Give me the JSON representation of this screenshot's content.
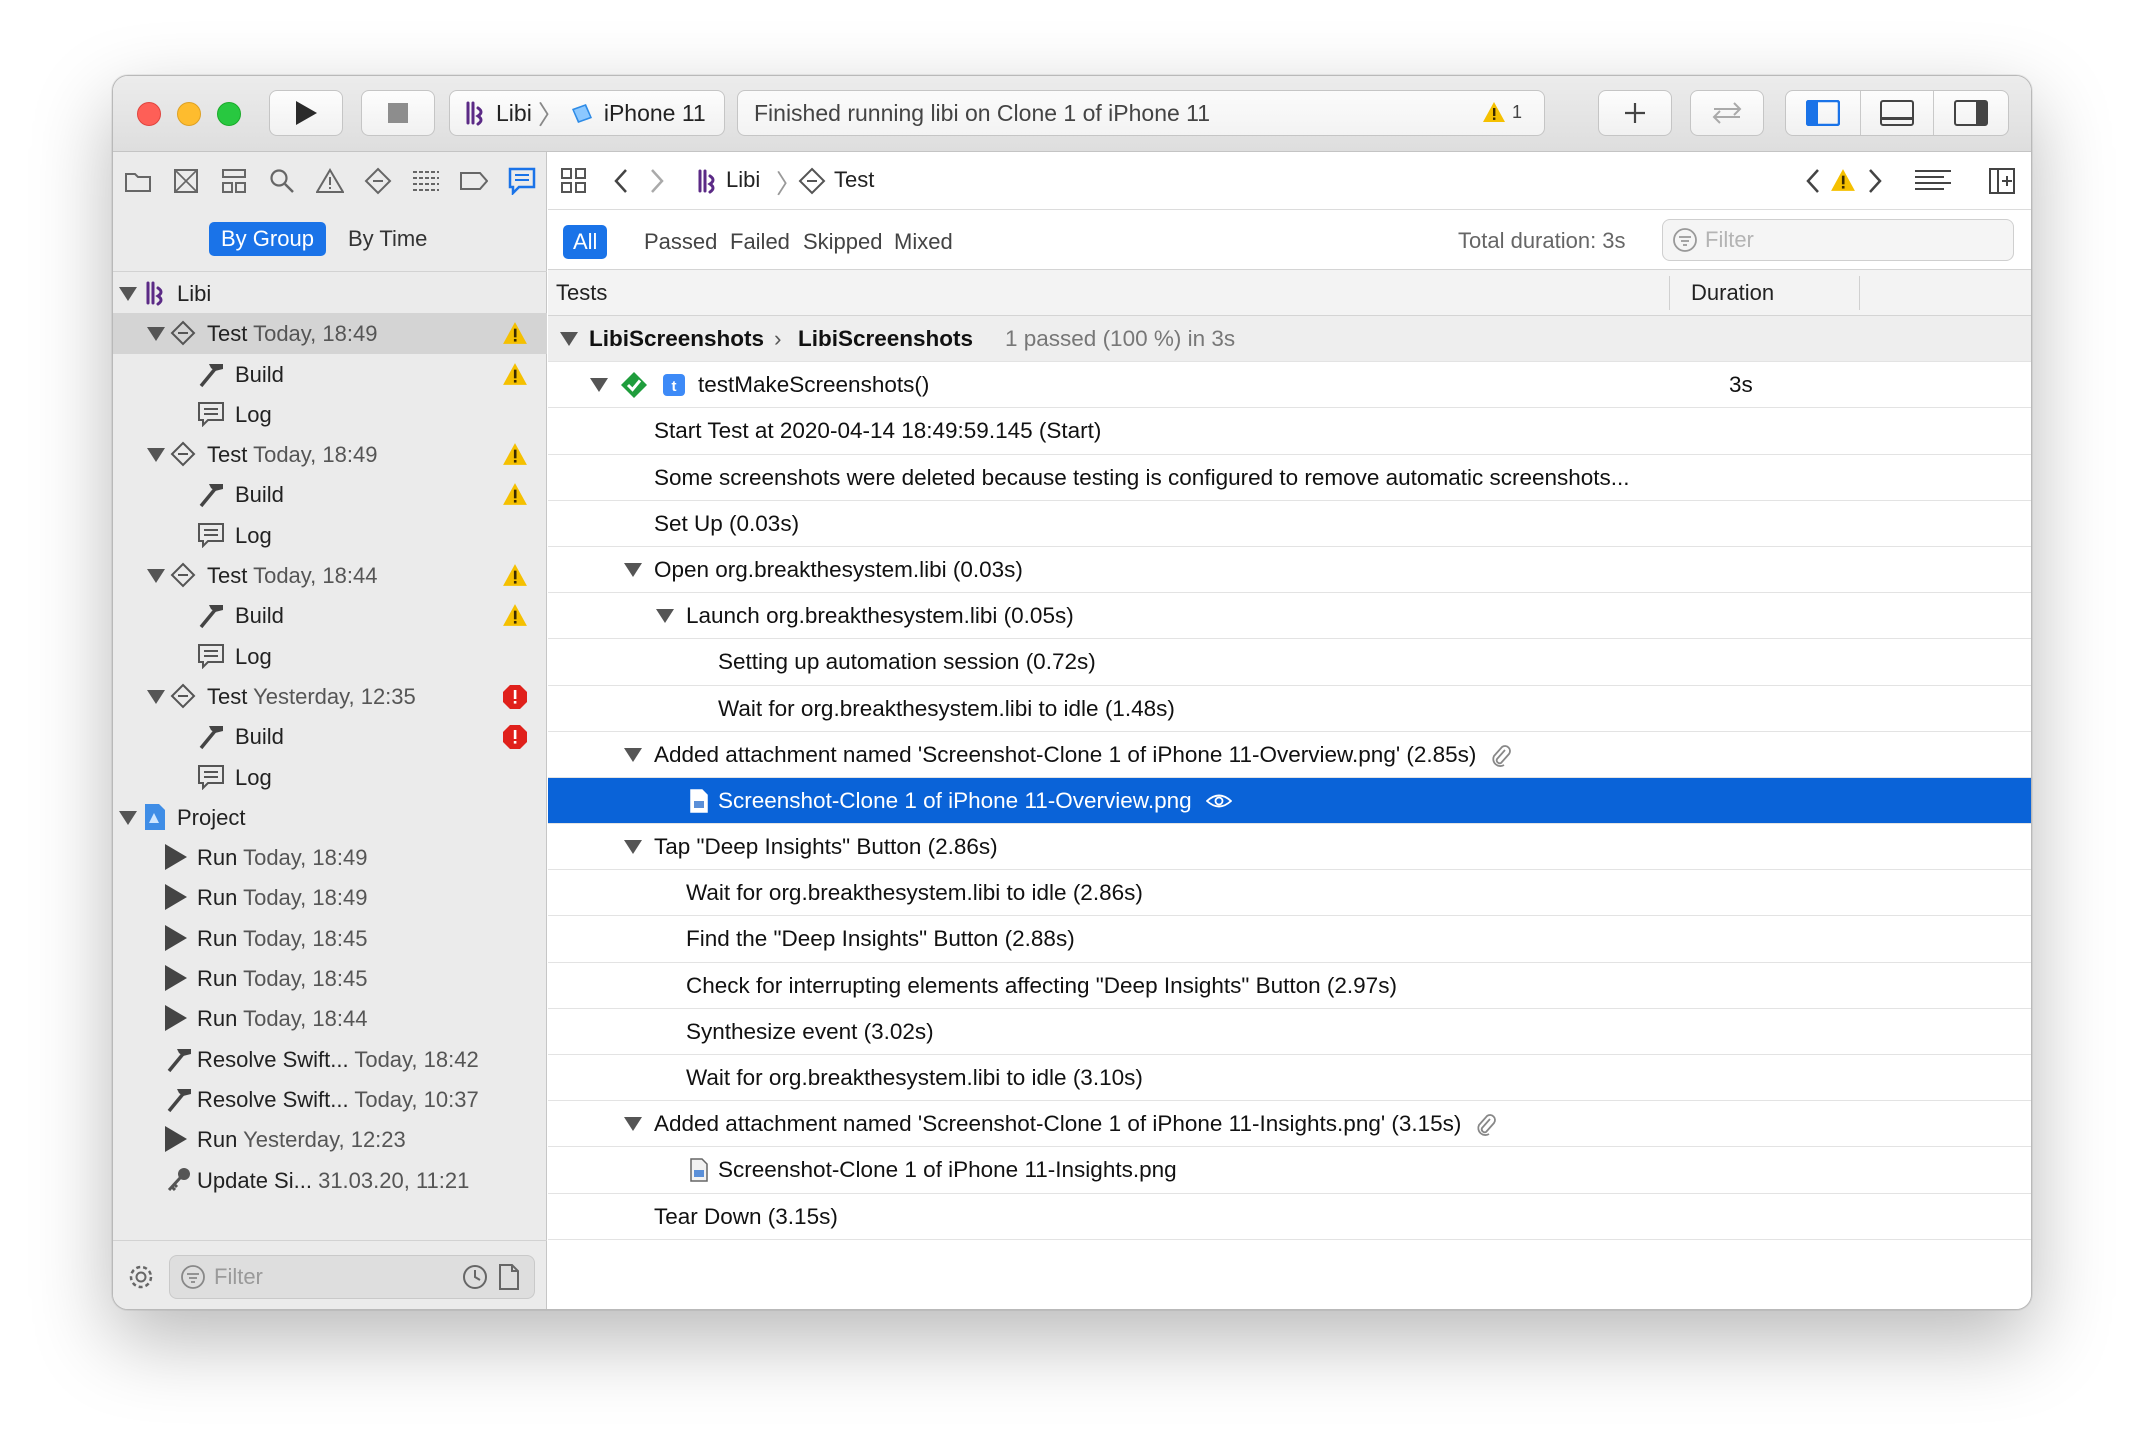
{
  "toolbar": {
    "scheme_app": "Libi",
    "scheme_device": "iPhone 11",
    "status_text": "Finished running libi on Clone 1 of iPhone 11",
    "warning_count": "1"
  },
  "navigator": {
    "seg_by_group": "By Group",
    "seg_by_time": "By Time",
    "filter_placeholder": "Filter",
    "tree": [
      {
        "label": "Libi",
        "date": "",
        "kind": "app",
        "level": 0,
        "badge": "",
        "expanded": true,
        "selected": false
      },
      {
        "label": "Test",
        "date": "Today, 18:49",
        "kind": "test",
        "level": 1,
        "badge": "warning",
        "expanded": true,
        "selected": true
      },
      {
        "label": "Build",
        "date": "",
        "kind": "build",
        "level": 2,
        "badge": "warning",
        "expanded": false,
        "selected": false
      },
      {
        "label": "Log",
        "date": "",
        "kind": "log",
        "level": 2,
        "badge": "",
        "expanded": false,
        "selected": false
      },
      {
        "label": "Test",
        "date": "Today, 18:49",
        "kind": "test",
        "level": 1,
        "badge": "warning",
        "expanded": true,
        "selected": false
      },
      {
        "label": "Build",
        "date": "",
        "kind": "build",
        "level": 2,
        "badge": "warning",
        "expanded": false,
        "selected": false
      },
      {
        "label": "Log",
        "date": "",
        "kind": "log",
        "level": 2,
        "badge": "",
        "expanded": false,
        "selected": false
      },
      {
        "label": "Test",
        "date": "Today, 18:44",
        "kind": "test",
        "level": 1,
        "badge": "warning",
        "expanded": true,
        "selected": false
      },
      {
        "label": "Build",
        "date": "",
        "kind": "build",
        "level": 2,
        "badge": "warning",
        "expanded": false,
        "selected": false
      },
      {
        "label": "Log",
        "date": "",
        "kind": "log",
        "level": 2,
        "badge": "",
        "expanded": false,
        "selected": false
      },
      {
        "label": "Test",
        "date": "Yesterday, 12:35",
        "kind": "test",
        "level": 1,
        "badge": "error",
        "expanded": true,
        "selected": false
      },
      {
        "label": "Build",
        "date": "",
        "kind": "build",
        "level": 2,
        "badge": "error",
        "expanded": false,
        "selected": false
      },
      {
        "label": "Log",
        "date": "",
        "kind": "log",
        "level": 2,
        "badge": "",
        "expanded": false,
        "selected": false
      },
      {
        "label": "Project",
        "date": "",
        "kind": "project",
        "level": 0,
        "badge": "",
        "expanded": true,
        "selected": false
      },
      {
        "label": "Run",
        "date": "Today, 18:49",
        "kind": "run",
        "level": 1,
        "badge": "",
        "expanded": false,
        "selected": false
      },
      {
        "label": "Run",
        "date": "Today, 18:49",
        "kind": "run",
        "level": 1,
        "badge": "",
        "expanded": false,
        "selected": false
      },
      {
        "label": "Run",
        "date": "Today, 18:45",
        "kind": "run",
        "level": 1,
        "badge": "",
        "expanded": false,
        "selected": false
      },
      {
        "label": "Run",
        "date": "Today, 18:45",
        "kind": "run",
        "level": 1,
        "badge": "",
        "expanded": false,
        "selected": false
      },
      {
        "label": "Run",
        "date": "Today, 18:44",
        "kind": "run",
        "level": 1,
        "badge": "",
        "expanded": false,
        "selected": false
      },
      {
        "label": "Resolve Swift...",
        "date": "Today, 18:42",
        "kind": "build",
        "level": 1,
        "badge": "",
        "expanded": false,
        "selected": false
      },
      {
        "label": "Resolve Swift...",
        "date": "Today, 10:37",
        "kind": "build",
        "level": 1,
        "badge": "",
        "expanded": false,
        "selected": false
      },
      {
        "label": "Run",
        "date": "Yesterday, 12:23",
        "kind": "run",
        "level": 1,
        "badge": "",
        "expanded": false,
        "selected": false
      },
      {
        "label": "Update Si...",
        "date": "31.03.20, 11:21",
        "kind": "key",
        "level": 1,
        "badge": "",
        "expanded": false,
        "selected": false
      }
    ]
  },
  "editor": {
    "breadcrumb_app": "Libi",
    "breadcrumb_item": "Test",
    "filter_tabs": [
      "All",
      "Passed",
      "Failed",
      "Skipped",
      "Mixed"
    ],
    "total_duration": "Total duration: 3s",
    "filter_placeholder": "Filter",
    "col_tests": "Tests",
    "col_duration": "Duration",
    "group_row": {
      "suite": "LibiScreenshots",
      "class": "LibiScreenshots",
      "summary": "1 passed (100 %) in 3s"
    },
    "test_row": {
      "name": "testMakeScreenshots()",
      "duration": "3s"
    },
    "activities": [
      {
        "text": "Start Test at 2020-04-14 18:49:59.145 (Start)",
        "indent": 0,
        "disclosure": false,
        "icon": ""
      },
      {
        "text": "Some screenshots were deleted because testing is configured to remove automatic screenshots...",
        "indent": 0,
        "disclosure": false,
        "icon": ""
      },
      {
        "text": "Set Up (0.03s)",
        "indent": 0,
        "disclosure": false,
        "icon": ""
      },
      {
        "text": "Open org.breakthesystem.libi (0.03s)",
        "indent": 0,
        "disclosure": true,
        "icon": ""
      },
      {
        "text": "Launch org.breakthesystem.libi (0.05s)",
        "indent": 1,
        "disclosure": true,
        "icon": ""
      },
      {
        "text": "Setting up automation session (0.72s)",
        "indent": 2,
        "disclosure": false,
        "icon": ""
      },
      {
        "text": "Wait for org.breakthesystem.libi to idle (1.48s)",
        "indent": 2,
        "disclosure": false,
        "icon": ""
      },
      {
        "text": "Added attachment named 'Screenshot-Clone 1 of iPhone 11-Overview.png' (2.85s)",
        "indent": 0,
        "disclosure": true,
        "icon": "paperclip"
      },
      {
        "text": "Screenshot-Clone 1 of iPhone 11-Overview.png",
        "indent": 1,
        "disclosure": false,
        "icon": "eye",
        "file": true,
        "selected": true
      },
      {
        "text": "Tap \"Deep Insights\" Button (2.86s)",
        "indent": 0,
        "disclosure": true,
        "icon": ""
      },
      {
        "text": "Wait for org.breakthesystem.libi to idle (2.86s)",
        "indent": 1,
        "disclosure": false,
        "icon": ""
      },
      {
        "text": "Find the \"Deep Insights\" Button (2.88s)",
        "indent": 1,
        "disclosure": false,
        "icon": ""
      },
      {
        "text": "Check for interrupting elements affecting \"Deep Insights\" Button (2.97s)",
        "indent": 1,
        "disclosure": false,
        "icon": ""
      },
      {
        "text": "Synthesize event (3.02s)",
        "indent": 1,
        "disclosure": false,
        "icon": ""
      },
      {
        "text": "Wait for org.breakthesystem.libi to idle (3.10s)",
        "indent": 1,
        "disclosure": false,
        "icon": ""
      },
      {
        "text": "Added attachment named 'Screenshot-Clone 1 of iPhone 11-Insights.png' (3.15s)",
        "indent": 0,
        "disclosure": true,
        "icon": "paperclip"
      },
      {
        "text": "Screenshot-Clone 1 of iPhone 11-Insights.png",
        "indent": 1,
        "disclosure": false,
        "icon": "",
        "file": true
      },
      {
        "text": "Tear Down (3.15s)",
        "indent": 0,
        "disclosure": false,
        "icon": ""
      }
    ]
  },
  "colors": {
    "accent": "#1a73e8",
    "selection": "#0a63d8",
    "warning": "#f5c000",
    "error": "#e0201b",
    "success": "#1f9d3c"
  }
}
